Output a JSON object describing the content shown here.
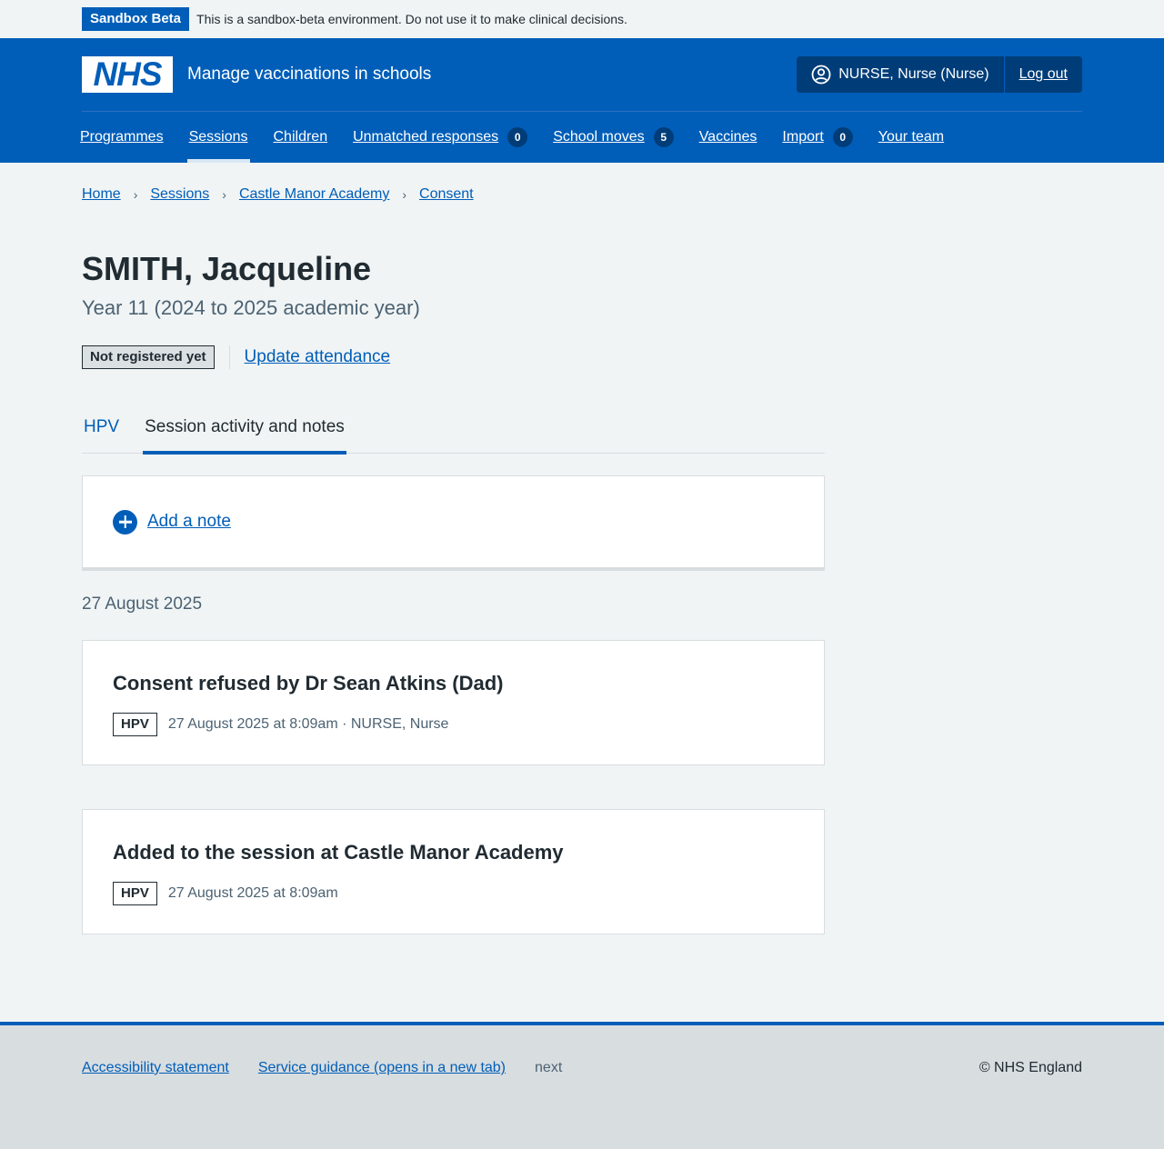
{
  "sandbox": {
    "tag": "Sandbox Beta",
    "message": "This is a sandbox-beta environment. Do not use it to make clinical decisions."
  },
  "header": {
    "logo_text": "NHS",
    "service_name": "Manage vaccinations in schools",
    "user": "NURSE, Nurse (Nurse)",
    "logout": "Log out"
  },
  "nav": {
    "items": [
      {
        "label": "Programmes"
      },
      {
        "label": "Sessions"
      },
      {
        "label": "Children"
      },
      {
        "label": "Unmatched responses",
        "count": "0"
      },
      {
        "label": "School moves",
        "count": "5"
      },
      {
        "label": "Vaccines"
      },
      {
        "label": "Import",
        "count": "0"
      },
      {
        "label": "Your team"
      }
    ]
  },
  "breadcrumb": [
    "Home",
    "Sessions",
    "Castle Manor Academy",
    "Consent"
  ],
  "page": {
    "title": "SMITH, Jacqueline",
    "caption": "Year 11 (2024 to 2025 academic year)",
    "status_tag": "Not registered yet",
    "update_attendance": "Update attendance"
  },
  "tabs": [
    {
      "label": "HPV"
    },
    {
      "label": "Session activity and notes"
    }
  ],
  "add_note": "Add a note",
  "date_heading": "27 August 2025",
  "events": [
    {
      "title": "Consent refused by Dr Sean Atkins (Dad)",
      "tag": "HPV",
      "meta": "27 August 2025 at 8:09am · NURSE, Nurse"
    },
    {
      "title": "Added to the session at Castle Manor Academy",
      "tag": "HPV",
      "meta": "27 August 2025 at 8:09am"
    }
  ],
  "footer": {
    "accessibility": "Accessibility statement",
    "guidance": "Service guidance (opens in a new tab)",
    "version": "next",
    "copyright": "© NHS England"
  },
  "colors": {
    "nhs_blue": "#005eb8",
    "dark_blue": "#003d78",
    "background": "#f0f4f5",
    "secondary_text": "#4c6272"
  }
}
